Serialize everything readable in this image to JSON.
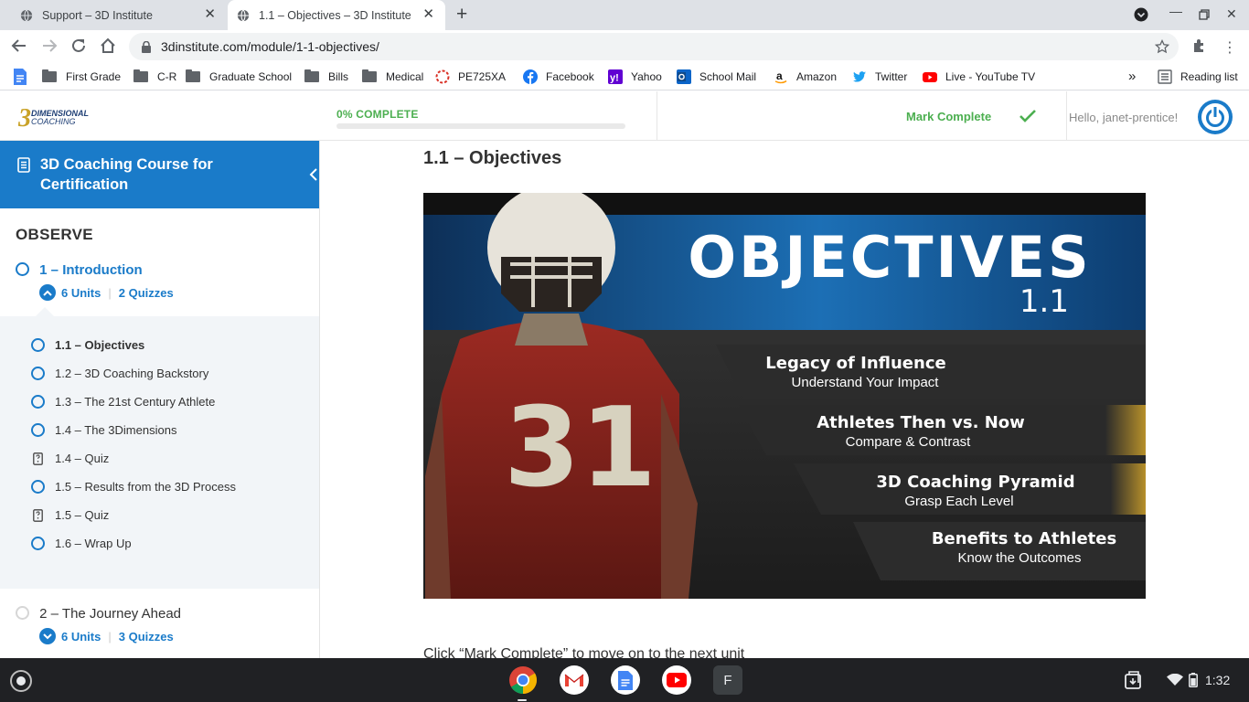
{
  "browser": {
    "tabs": [
      {
        "title": "Support – 3D Institute",
        "active": false
      },
      {
        "title": "1.1 – Objectives – 3D Institute",
        "active": true
      }
    ],
    "url": "3dinstitute.com/module/1-1-objectives/",
    "bookmarks": [
      {
        "label": "First Grade",
        "icon": "folder-icon"
      },
      {
        "label": "C-R",
        "icon": "folder-icon"
      },
      {
        "label": "Graduate School",
        "icon": "folder-icon"
      },
      {
        "label": "Bills",
        "icon": "folder-icon"
      },
      {
        "label": "Medical",
        "icon": "folder-icon"
      },
      {
        "label": "PE725XA",
        "icon": "dashed-circle-icon"
      },
      {
        "label": "Facebook",
        "icon": "facebook-icon"
      },
      {
        "label": "Yahoo",
        "icon": "yahoo-icon"
      },
      {
        "label": "School Mail",
        "icon": "outlook-icon"
      },
      {
        "label": "Amazon",
        "icon": "amazon-icon"
      },
      {
        "label": "Twitter",
        "icon": "twitter-icon"
      },
      {
        "label": "Live - YouTube TV",
        "icon": "youtube-tv-icon"
      }
    ],
    "reading_list": "Reading list",
    "overflow": "»"
  },
  "site": {
    "logo_text_1": "DIMENSIONAL",
    "logo_text_2": "COACHING",
    "logo_numeral": "3",
    "progress_label": "0% COMPLETE",
    "progress_fraction": 0,
    "mark_complete": "Mark Complete",
    "greeting": "Hello, janet-prentice!",
    "accent": "#1a7bc9",
    "success": "#4caf50"
  },
  "sidebar": {
    "course_title": "3D Coaching Course for Certification",
    "section": "OBSERVE",
    "lesson1": {
      "title": "1 – Introduction",
      "units": "6 Units",
      "quizzes": "2 Quizzes"
    },
    "units": [
      {
        "label": "1.1 – Objectives",
        "type": "unit",
        "current": true
      },
      {
        "label": "1.2 – 3D Coaching Backstory",
        "type": "unit"
      },
      {
        "label": "1.3 – The 21st Century Athlete",
        "type": "unit"
      },
      {
        "label": "1.4 – The 3Dimensions",
        "type": "unit"
      },
      {
        "label": "1.4 – Quiz",
        "type": "quiz"
      },
      {
        "label": "1.5 – Results from the 3D Process",
        "type": "unit"
      },
      {
        "label": "1.5 – Quiz",
        "type": "quiz"
      },
      {
        "label": "1.6 – Wrap Up",
        "type": "unit"
      }
    ],
    "lesson2": {
      "title": "2 – The Journey Ahead",
      "units": "6 Units",
      "quizzes": "3 Quizzes"
    }
  },
  "main": {
    "title": "1.1 – Objectives",
    "hero": {
      "heading": "OBJECTIVES",
      "number": "1.1",
      "jersey": "31",
      "items": [
        {
          "title": "Legacy of Influence",
          "sub": "Understand Your Impact"
        },
        {
          "title": "Athletes Then vs. Now",
          "sub": "Compare & Contrast"
        },
        {
          "title": "3D Coaching Pyramid",
          "sub": "Grasp Each Level"
        },
        {
          "title": "Benefits to Athletes",
          "sub": "Know the Outcomes"
        }
      ]
    },
    "instruction": "Click “Mark Complete” to move on to the next unit"
  },
  "taskbar": {
    "apps": [
      "chrome-icon",
      "gmail-icon",
      "docs-icon",
      "youtube-icon",
      "f-app-icon"
    ],
    "f_app_letter": "F",
    "time": "1:32"
  }
}
